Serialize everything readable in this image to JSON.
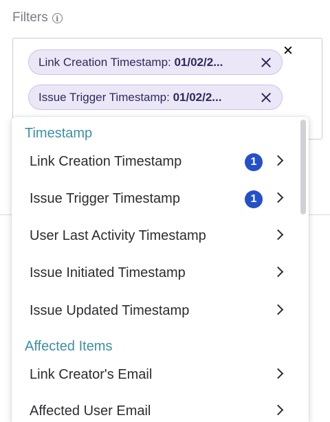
{
  "filters": {
    "label": "Filters",
    "info_icon": "info-icon",
    "chips": [
      {
        "name": "Link Creation Timestamp: ",
        "value": "01/02/2..."
      },
      {
        "name": "Issue Trigger Timestamp: ",
        "value": "01/02/2..."
      }
    ]
  },
  "dropdown": {
    "groups": [
      {
        "title": "Timestamp",
        "items": [
          {
            "label": "Link Creation Timestamp",
            "badge": "1"
          },
          {
            "label": "Issue Trigger Timestamp",
            "badge": "1"
          },
          {
            "label": "User Last Activity Timestamp"
          },
          {
            "label": "Issue Initiated Timestamp"
          },
          {
            "label": "Issue Updated Timestamp"
          }
        ]
      },
      {
        "title": "Affected Items",
        "items": [
          {
            "label": "Link Creator's Email"
          },
          {
            "label": "Affected User Email"
          }
        ]
      }
    ]
  },
  "colors": {
    "chip_bg": "#ebe7f7",
    "badge": "#2450c9",
    "group_title": "#3b8fa6"
  }
}
